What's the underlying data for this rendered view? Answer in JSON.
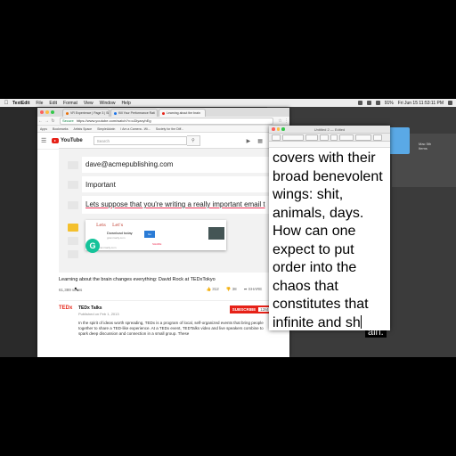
{
  "menubar": {
    "app": "TextEdit",
    "items": [
      "File",
      "Edit",
      "Format",
      "View",
      "Window",
      "Help"
    ],
    "clock": "Fri Jun 15  11:53:11 PM",
    "battery": "91%"
  },
  "chrome": {
    "tabs": [
      {
        "label": "VR Experience | Page 3 | Sl",
        "color": "#e8710a"
      },
      {
        "label": "Kill Your Performance Rati",
        "color": "#1a73e8"
      },
      {
        "label": "Learning about the brain",
        "color": "#e62117"
      }
    ],
    "secure_label": "Secure",
    "url": "https://www.youtube.com/watch?v=uDiyaxyhEg",
    "bookmarks": [
      "Apps",
      "Bookmarks",
      "Artists Space",
      "SimpleAdwin",
      "I Am a Camera - Wi...",
      "Society for the Diff..."
    ]
  },
  "youtube": {
    "logo": "YouTube",
    "search_placeholder": "Search",
    "video_email": "dave@acmepublishing.com",
    "video_subject": "Important",
    "video_body": "Lets suppose that you're writing a really important email t",
    "popup": {
      "cap1": "Lets",
      "cap2": "Let's",
      "download": "Download today",
      "site": "grammarly.com",
      "btn": "Go",
      "tiny": "SHARE",
      "footer": "grammarly.com"
    },
    "video_title": "Learning about the brain changes everything: David Rock at TEDxTokyo",
    "views": "61,389 views",
    "likes": "312",
    "dislikes": "38",
    "share": "SHARE",
    "more": "...",
    "channel_logo": "TEDx",
    "channel_name": "TEDx Talks",
    "published": "Published on Feb 1, 2013",
    "subscribe": "SUBSCRIBE",
    "sub_count": "12M",
    "description": "In the spirit of ideas worth spreading, TEDx is a program of local, self-organized events that bring people together to share a TED-like experience. At a TEDx event, TEDTalks video and live speakers combine to spark deep discussion and connection in a small group. These"
  },
  "textedit": {
    "title": "Untitled 2 — Edited",
    "lines": [
      "covers with their",
      "broad benevolent",
      "wings: shit,",
      "animals, days.",
      "How can one",
      "expect to put",
      "order into the",
      "chaos that",
      "constitutes that",
      "infinite and sh"
    ]
  },
  "desktop": {
    "caption": "ain.",
    "side_text": [
      "Mac 5th",
      "Items"
    ]
  }
}
